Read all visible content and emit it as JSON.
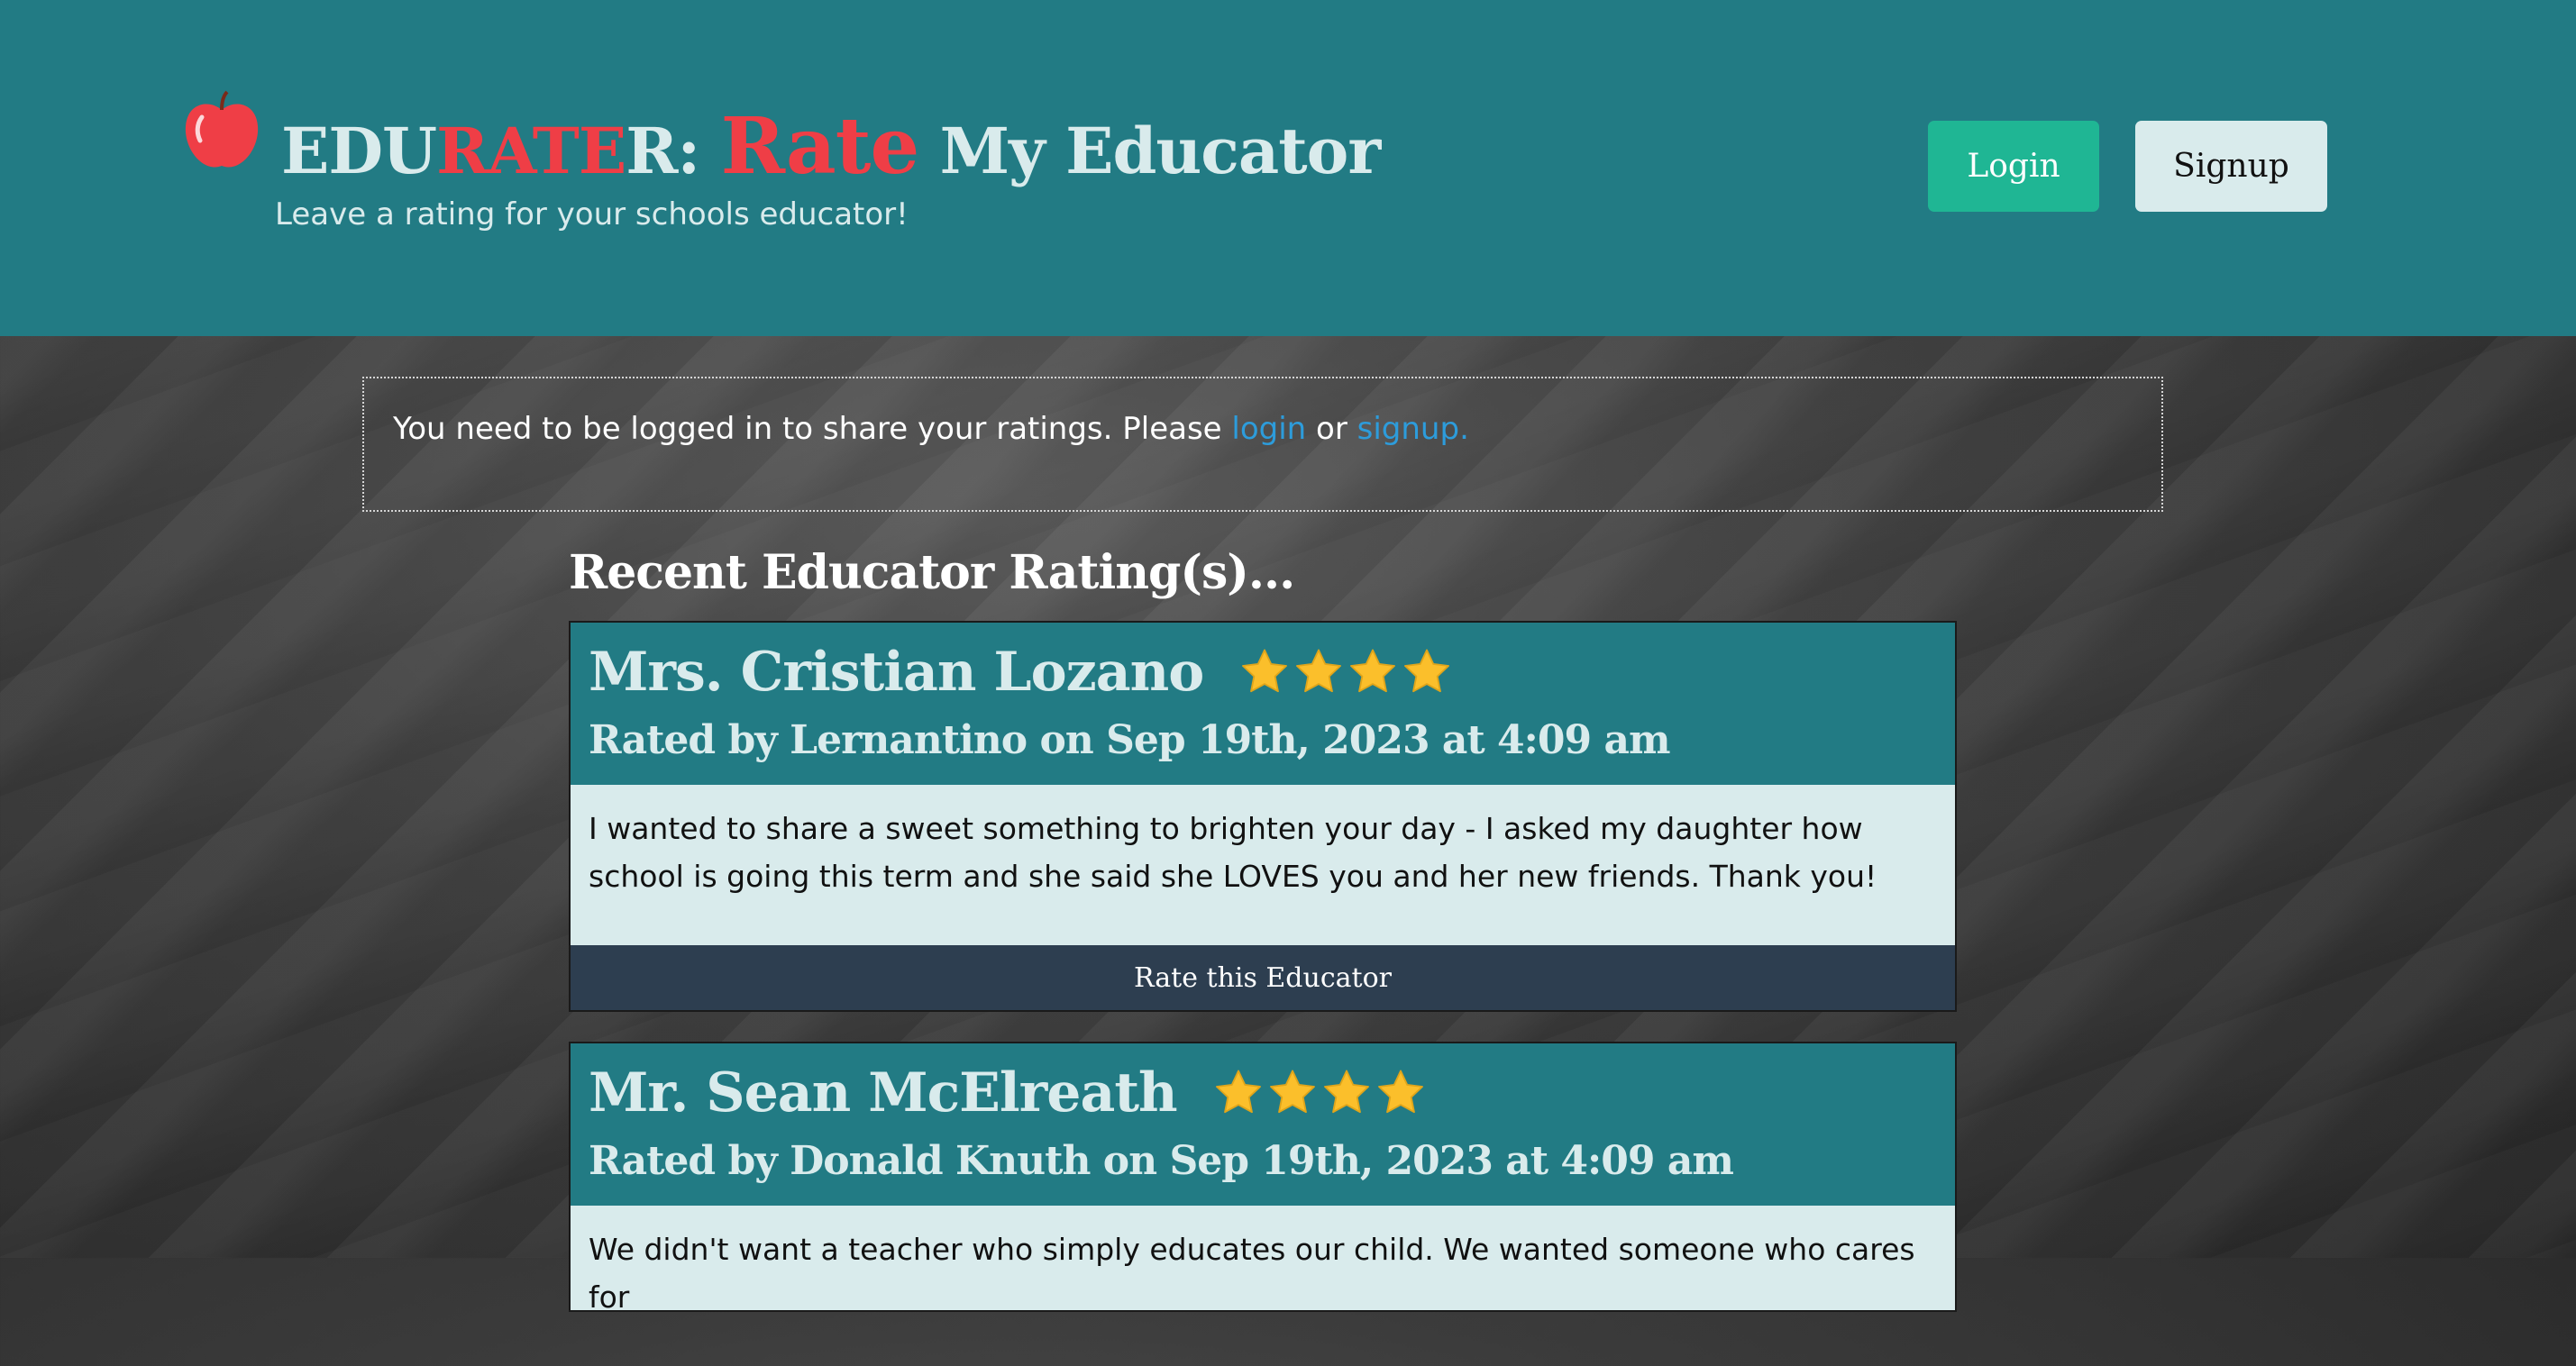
{
  "header": {
    "logo": {
      "part1": "EDU",
      "part2": "RATE",
      "part3": "R: ",
      "part4": "Rate",
      "part5": " My Educator"
    },
    "tagline": "Leave a rating for your schools educator!",
    "login_label": "Login",
    "signup_label": "Signup"
  },
  "notice": {
    "text": "You need to be logged in to share your ratings. Please ",
    "login_link": "login",
    "or_text": " or ",
    "signup_link": "signup."
  },
  "section_title": "Recent Educator Rating(s)...",
  "ratings": [
    {
      "educator": "Mrs. Cristian Lozano",
      "stars": 4,
      "rated_by": "Rated by Lernantino on Sep 19th, 2023 at 4:09 am",
      "comment": "I wanted to share a sweet something to brighten your day - I asked my daughter how school is going this term and she said she LOVES you and her new friends. Thank you!",
      "button_label": "Rate this Educator"
    },
    {
      "educator": "Mr. Sean McElreath",
      "stars": 4,
      "rated_by": "Rated by Donald Knuth on Sep 19th, 2023 at 4:09 am",
      "comment": "We didn't want a teacher who simply educates our child. We wanted someone who cares for"
    }
  ],
  "colors": {
    "header_bg": "#227b84",
    "accent_red": "#ef3e46",
    "login_green": "#1fb694",
    "star_gold": "#fbbf2b",
    "link_blue": "#2d9cdb",
    "button_navy": "#2d3e50"
  },
  "icons": {
    "logo": "apple-icon",
    "rating": "star-icon"
  }
}
